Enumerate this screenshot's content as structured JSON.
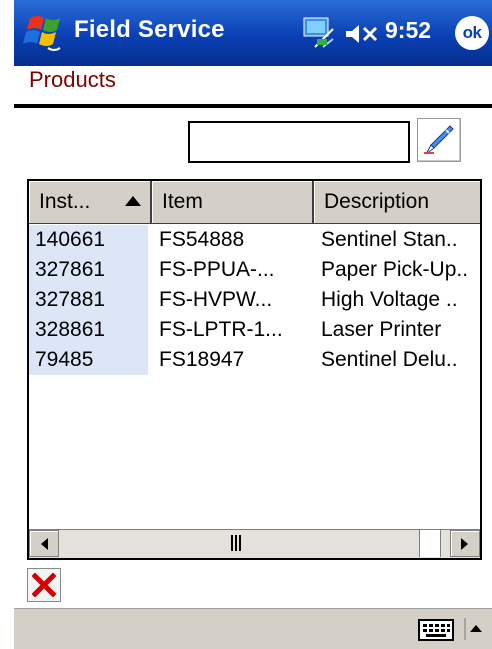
{
  "titlebar": {
    "app_title": "Field Service",
    "time": "9:52",
    "ok_label": "ok"
  },
  "page": {
    "title": "Products"
  },
  "search": {
    "value": "",
    "placeholder": ""
  },
  "list": {
    "columns": [
      "Inst...",
      "Item",
      "Description"
    ],
    "sort": {
      "column": "Inst...",
      "direction": "ascending"
    },
    "rows": [
      [
        "140661",
        "FS54888",
        "Sentinel Stan.."
      ],
      [
        "327861",
        "FS-PPUA-...",
        "Paper Pick-Up.."
      ],
      [
        "327881",
        "FS-HVPW...",
        "High Voltage .."
      ],
      [
        "328861",
        "FS-LPTR-1...",
        "Laser Printer"
      ],
      [
        "79485",
        "FS18947",
        "Sentinel Delu.."
      ]
    ]
  },
  "icons": {
    "start": "windows-flag-icon",
    "connectivity": "connectivity-icon",
    "volume": "speaker-muted-icon",
    "find": "find-pen-icon",
    "delete": "delete-x-icon",
    "keyboard": "keyboard-icon",
    "sip_menu": "up-arrow-icon"
  },
  "colors": {
    "titlebar": "#0a3fb4",
    "page_title": "#800000",
    "selection": "#dde6f7",
    "delete": "#d40000"
  }
}
